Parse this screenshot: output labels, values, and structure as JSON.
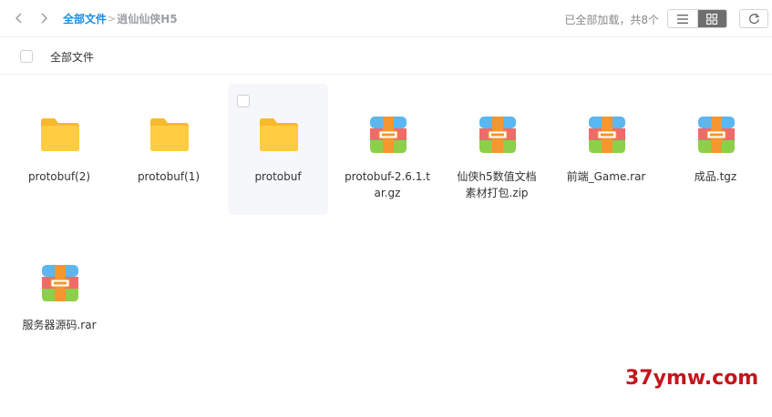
{
  "nav": {
    "back_icon": "chevron-left-icon",
    "forward_icon": "chevron-right-icon"
  },
  "breadcrumb": {
    "root": "全部文件",
    "separator": ">",
    "current": "逍仙仙侠H5"
  },
  "status": {
    "loaded_text": "已全部加载，共8个"
  },
  "view": {
    "list_icon": "list-icon",
    "grid_icon": "grid-icon",
    "active": "grid",
    "refresh_icon": "refresh-icon"
  },
  "select_all": {
    "label": "全部文件"
  },
  "colors": {
    "accent": "#1a8ce6",
    "folder": "#ffc83d",
    "archive_top": "#5ab7f0",
    "archive_mid": "#f06a6a",
    "archive_bottom": "#8cd04a",
    "archive_strap": "#f5962e",
    "watermark": "#c4161c"
  },
  "files": [
    {
      "name": "protobuf(2)",
      "type": "folder",
      "icon": "folder-icon"
    },
    {
      "name": "protobuf(1)",
      "type": "folder",
      "icon": "folder-icon"
    },
    {
      "name": "protobuf",
      "type": "folder",
      "icon": "folder-icon",
      "hovered": true
    },
    {
      "name": "protobuf-2.6.1.tar.gz",
      "type": "archive",
      "icon": "archive-icon"
    },
    {
      "name": "仙侠h5数值文档素材打包.zip",
      "type": "archive",
      "icon": "archive-icon"
    },
    {
      "name": "前端_Game.rar",
      "type": "archive",
      "icon": "archive-icon"
    },
    {
      "name": "成品.tgz",
      "type": "archive",
      "icon": "archive-icon"
    },
    {
      "name": "服务器源码.rar",
      "type": "archive",
      "icon": "archive-icon"
    }
  ],
  "watermark": "37ymw.com"
}
